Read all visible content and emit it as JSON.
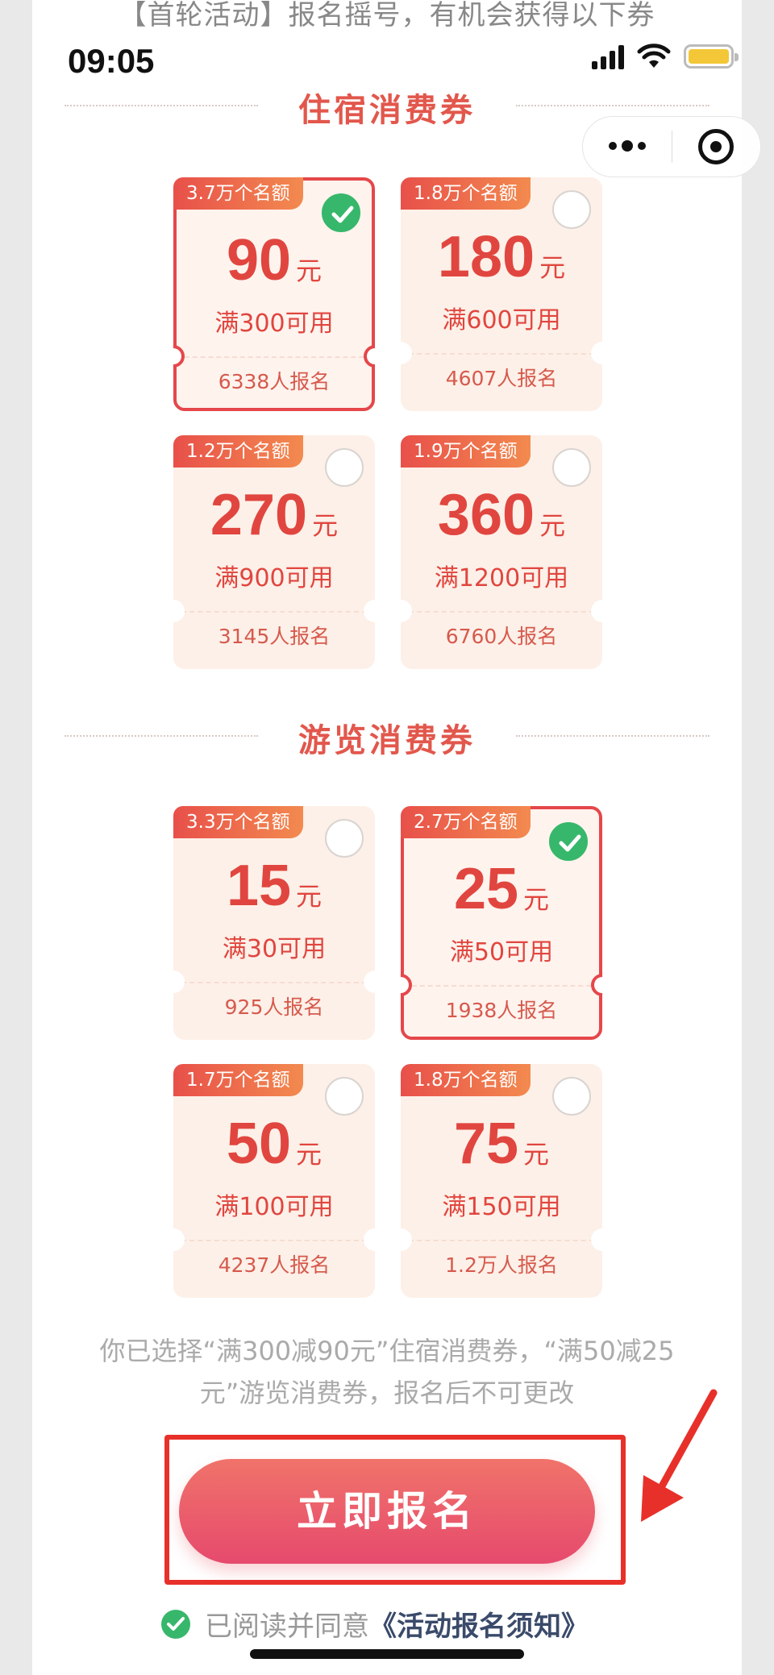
{
  "banner": "【首轮活动】报名摇号，有机会获得以下券",
  "status": {
    "time": "09:05"
  },
  "sections": [
    {
      "title": "住宿消费券",
      "coupons": [
        {
          "quota": "3.7万个名额",
          "amount": "90",
          "unit": "元",
          "condition": "满300可用",
          "count": "6338人报名",
          "selected": true
        },
        {
          "quota": "1.8万个名额",
          "amount": "180",
          "unit": "元",
          "condition": "满600可用",
          "count": "4607人报名",
          "selected": false
        },
        {
          "quota": "1.2万个名额",
          "amount": "270",
          "unit": "元",
          "condition": "满900可用",
          "count": "3145人报名",
          "selected": false
        },
        {
          "quota": "1.9万个名额",
          "amount": "360",
          "unit": "元",
          "condition": "满1200可用",
          "count": "6760人报名",
          "selected": false
        }
      ]
    },
    {
      "title": "游览消费券",
      "coupons": [
        {
          "quota": "3.3万个名额",
          "amount": "15",
          "unit": "元",
          "condition": "满30可用",
          "count": "925人报名",
          "selected": false
        },
        {
          "quota": "2.7万个名额",
          "amount": "25",
          "unit": "元",
          "condition": "满50可用",
          "count": "1938人报名",
          "selected": true
        },
        {
          "quota": "1.7万个名额",
          "amount": "50",
          "unit": "元",
          "condition": "满100可用",
          "count": "4237人报名",
          "selected": false
        },
        {
          "quota": "1.8万个名额",
          "amount": "75",
          "unit": "元",
          "condition": "满150可用",
          "count": "1.2万人报名",
          "selected": false
        }
      ]
    }
  ],
  "summary": {
    "line1": "你已选择“满300减90元”住宿消费券，“满50减25",
    "line2": "元”游览消费券，报名后不可更改"
  },
  "join_button": "立即报名",
  "agreement": {
    "text": "已阅读并同意",
    "link": "《活动报名须知》"
  },
  "colors": {
    "accent": "#e2574c",
    "selected_border": "#e5474a",
    "check_green": "#37b76b",
    "highlight_red": "#e8302a"
  }
}
